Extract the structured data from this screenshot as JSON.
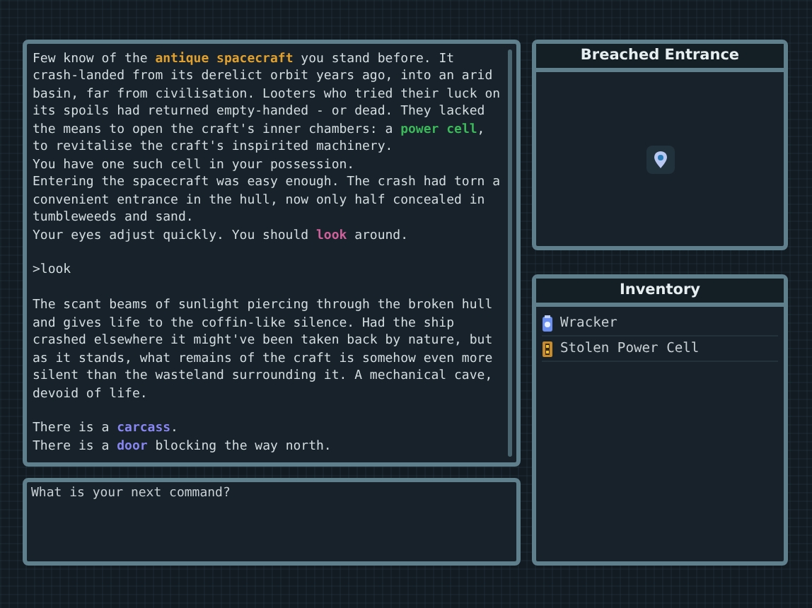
{
  "log": {
    "blocks": [
      [
        [
          {
            "text": "Few know of the "
          },
          {
            "text": "antique spacecraft",
            "color": "#e0a030"
          },
          {
            "text": " you stand before. It crash-landed from its derelict orbit years ago, into an arid basin, far from civilisation. Looters who tried their luck on its spoils had returned empty-handed - or dead. They lacked the means to open the craft's inner chambers: a "
          },
          {
            "text": "power cell",
            "color": "#3cb85a"
          },
          {
            "text": ", to revitalise the craft's inspirited machinery."
          }
        ],
        [
          {
            "text": "You have one such cell in your possession."
          }
        ],
        [
          {
            "text": "Entering the spacecraft was easy enough. The crash had torn a convenient entrance in the hull, now only half concealed in tumbleweeds and sand."
          }
        ],
        [
          {
            "text": "Your eyes adjust quickly. You should "
          },
          {
            "text": "look",
            "color": "#d0609a"
          },
          {
            "text": " around."
          }
        ]
      ],
      [
        [
          {
            "text": ">look"
          }
        ]
      ],
      [
        [
          {
            "text": "The scant beams of sunlight piercing through the broken hull and gives life to the coffin-like silence. Had the ship crashed elsewhere it might've been taken back by nature, but as it stands, what remains of the craft is somehow even more silent than the wasteland surrounding it. A mechanical cave, devoid of life."
          }
        ]
      ],
      [
        [
          {
            "text": "There is a "
          },
          {
            "text": "carcass",
            "color": "#8886f0"
          },
          {
            "text": "."
          }
        ],
        [
          {
            "text": "There is a "
          },
          {
            "text": "door",
            "color": "#8886f0"
          },
          {
            "text": " blocking the way north."
          }
        ]
      ]
    ]
  },
  "command": {
    "placeholder": "What is your next command?"
  },
  "map": {
    "title": "Breached Entrance"
  },
  "inventory": {
    "title": "Inventory",
    "items": [
      {
        "name": "Wracker",
        "kind": "tool"
      },
      {
        "name": "Stolen Power Cell",
        "kind": "cell"
      }
    ]
  }
}
